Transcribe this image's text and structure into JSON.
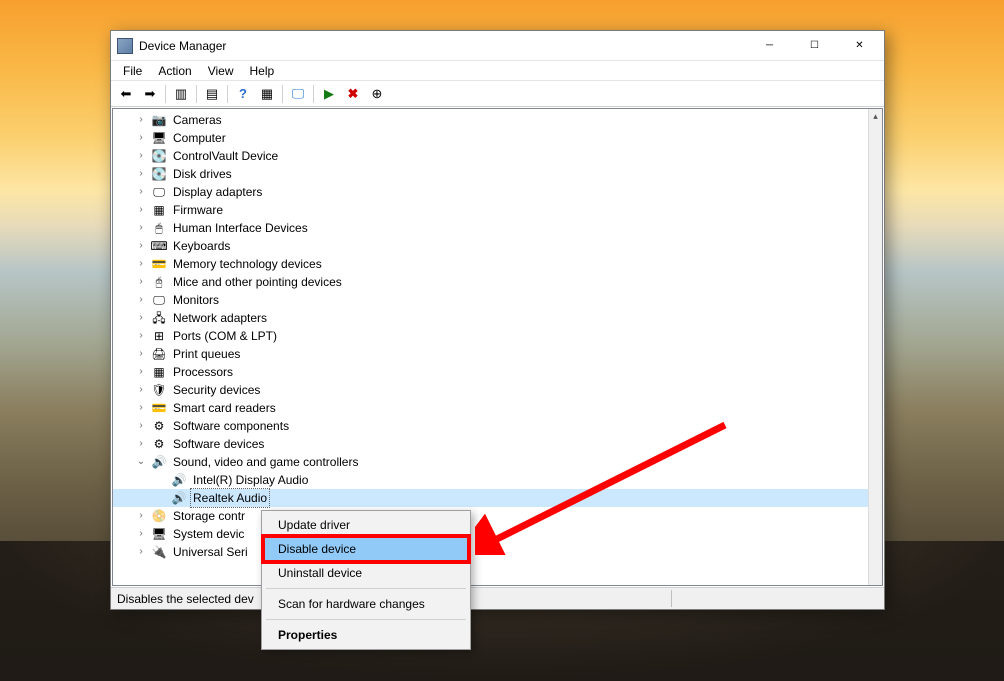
{
  "window": {
    "title": "Device Manager"
  },
  "menu": {
    "file": "File",
    "action": "Action",
    "view": "View",
    "help": "Help"
  },
  "tree": {
    "items": [
      {
        "label": "Cameras",
        "icon": "📷",
        "expandable": true
      },
      {
        "label": "Computer",
        "icon": "🖥",
        "expandable": true
      },
      {
        "label": "ControlVault Device",
        "icon": "💽",
        "expandable": true
      },
      {
        "label": "Disk drives",
        "icon": "💽",
        "expandable": true
      },
      {
        "label": "Display adapters",
        "icon": "🖵",
        "expandable": true
      },
      {
        "label": "Firmware",
        "icon": "▦",
        "expandable": true
      },
      {
        "label": "Human Interface Devices",
        "icon": "🖱",
        "expandable": true
      },
      {
        "label": "Keyboards",
        "icon": "⌨",
        "expandable": true
      },
      {
        "label": "Memory technology devices",
        "icon": "💳",
        "expandable": true
      },
      {
        "label": "Mice and other pointing devices",
        "icon": "🖰",
        "expandable": true
      },
      {
        "label": "Monitors",
        "icon": "🖵",
        "expandable": true
      },
      {
        "label": "Network adapters",
        "icon": "🖧",
        "expandable": true
      },
      {
        "label": "Ports (COM & LPT)",
        "icon": "⊞",
        "expandable": true
      },
      {
        "label": "Print queues",
        "icon": "🖨",
        "expandable": true
      },
      {
        "label": "Processors",
        "icon": "▦",
        "expandable": true
      },
      {
        "label": "Security devices",
        "icon": "🛡",
        "expandable": true
      },
      {
        "label": "Smart card readers",
        "icon": "💳",
        "expandable": true
      },
      {
        "label": "Software components",
        "icon": "⚙",
        "expandable": true
      },
      {
        "label": "Software devices",
        "icon": "⚙",
        "expandable": true
      },
      {
        "label": "Sound, video and game controllers",
        "icon": "🔊",
        "expandable": true,
        "expanded": true,
        "children": [
          {
            "label": "Intel(R) Display Audio",
            "icon": "🔊"
          },
          {
            "label": "Realtek Audio",
            "icon": "🔊",
            "selected": true
          }
        ]
      },
      {
        "label": "Storage contr",
        "icon": "📀",
        "expandable": true,
        "truncated": true
      },
      {
        "label": "System devic",
        "icon": "🖥",
        "expandable": true,
        "truncated": true
      },
      {
        "label": "Universal Seri",
        "icon": "🔌",
        "expandable": true,
        "truncated": true
      }
    ]
  },
  "contextMenu": {
    "items": [
      {
        "label": "Update driver"
      },
      {
        "label": "Disable device",
        "selected": true,
        "highlighted": true
      },
      {
        "label": "Uninstall device"
      },
      {
        "separator": true
      },
      {
        "label": "Scan for hardware changes"
      },
      {
        "separator": true
      },
      {
        "label": "Properties",
        "bold": true
      }
    ]
  },
  "statusbar": {
    "text": "Disables the selected dev"
  }
}
